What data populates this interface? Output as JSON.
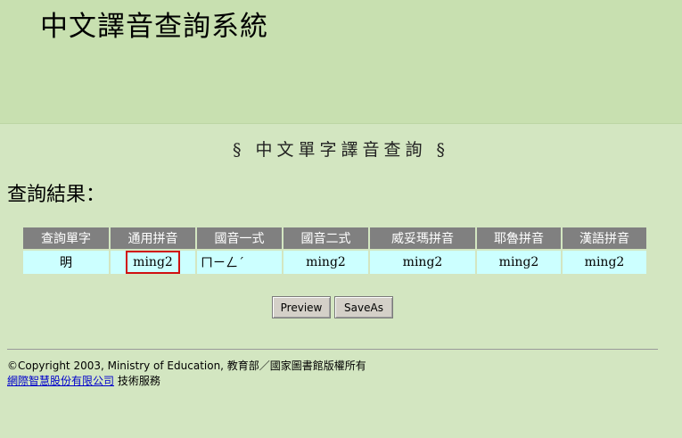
{
  "banner": {
    "title": "中文譯音查詢系統"
  },
  "subtitle": "§ 中文單字譯音查詢 §",
  "result_label": "查詢結果：",
  "table": {
    "headers": [
      "查詢單字",
      "通用拼音",
      "國音一式",
      "國音二式",
      "威妥瑪拼音",
      "耶魯拼音",
      "漢語拼音"
    ],
    "rows": [
      [
        "明",
        "ming2",
        "ㄇㄧㄥˊ",
        "ming2",
        "ming2",
        "ming2",
        "ming2"
      ]
    ]
  },
  "buttons": {
    "preview": "Preview",
    "saveas": "SaveAs"
  },
  "footer": {
    "copyright": "©Copyright 2003, Ministry of Education, 教育部／國家圖書館版權所有",
    "company_link": "網際智慧股份有限公司",
    "service_text": " 技術服務"
  },
  "colors": {
    "page_bg": "#d3e6c1",
    "banner_bg": "#c8e0b0",
    "header_bg": "#808080",
    "cell_bg": "#ccffff",
    "highlight_border": "#d01010"
  }
}
